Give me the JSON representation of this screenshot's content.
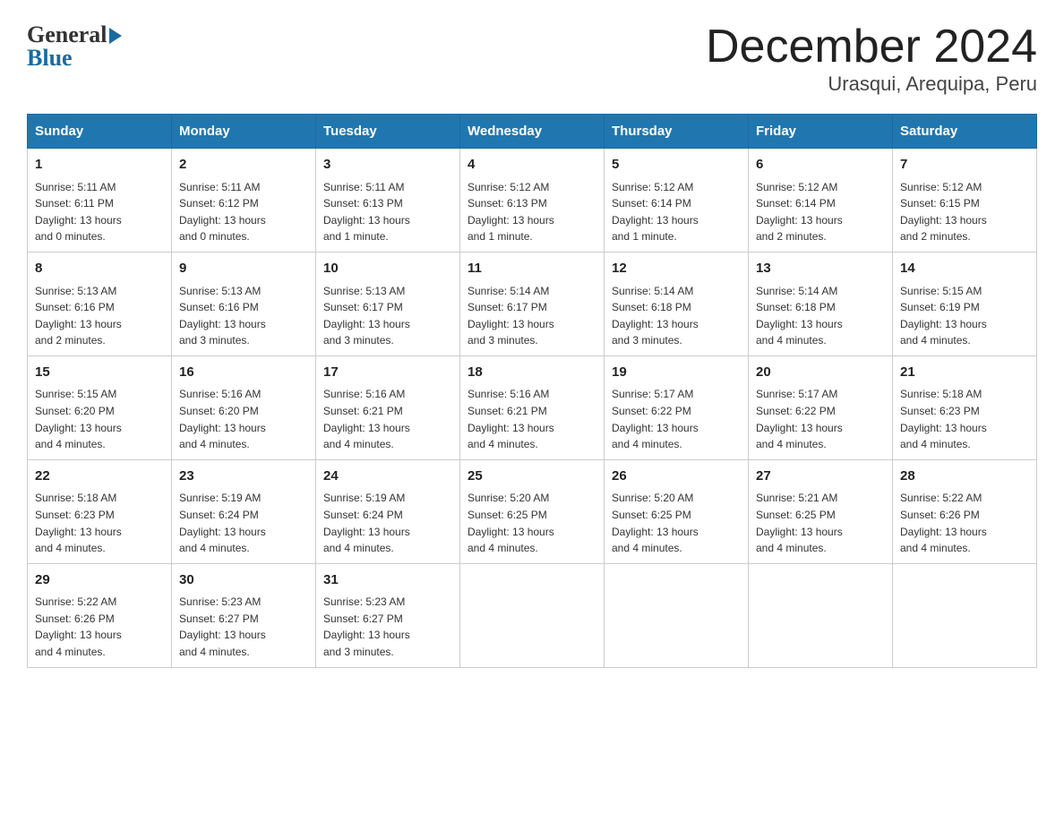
{
  "header": {
    "month_title": "December 2024",
    "location": "Urasqui, Arequipa, Peru",
    "logo_general": "General",
    "logo_blue": "Blue"
  },
  "days_of_week": [
    "Sunday",
    "Monday",
    "Tuesday",
    "Wednesday",
    "Thursday",
    "Friday",
    "Saturday"
  ],
  "weeks": [
    [
      {
        "day": "1",
        "info": "Sunrise: 5:11 AM\nSunset: 6:11 PM\nDaylight: 13 hours\nand 0 minutes."
      },
      {
        "day": "2",
        "info": "Sunrise: 5:11 AM\nSunset: 6:12 PM\nDaylight: 13 hours\nand 0 minutes."
      },
      {
        "day": "3",
        "info": "Sunrise: 5:11 AM\nSunset: 6:13 PM\nDaylight: 13 hours\nand 1 minute."
      },
      {
        "day": "4",
        "info": "Sunrise: 5:12 AM\nSunset: 6:13 PM\nDaylight: 13 hours\nand 1 minute."
      },
      {
        "day": "5",
        "info": "Sunrise: 5:12 AM\nSunset: 6:14 PM\nDaylight: 13 hours\nand 1 minute."
      },
      {
        "day": "6",
        "info": "Sunrise: 5:12 AM\nSunset: 6:14 PM\nDaylight: 13 hours\nand 2 minutes."
      },
      {
        "day": "7",
        "info": "Sunrise: 5:12 AM\nSunset: 6:15 PM\nDaylight: 13 hours\nand 2 minutes."
      }
    ],
    [
      {
        "day": "8",
        "info": "Sunrise: 5:13 AM\nSunset: 6:16 PM\nDaylight: 13 hours\nand 2 minutes."
      },
      {
        "day": "9",
        "info": "Sunrise: 5:13 AM\nSunset: 6:16 PM\nDaylight: 13 hours\nand 3 minutes."
      },
      {
        "day": "10",
        "info": "Sunrise: 5:13 AM\nSunset: 6:17 PM\nDaylight: 13 hours\nand 3 minutes."
      },
      {
        "day": "11",
        "info": "Sunrise: 5:14 AM\nSunset: 6:17 PM\nDaylight: 13 hours\nand 3 minutes."
      },
      {
        "day": "12",
        "info": "Sunrise: 5:14 AM\nSunset: 6:18 PM\nDaylight: 13 hours\nand 3 minutes."
      },
      {
        "day": "13",
        "info": "Sunrise: 5:14 AM\nSunset: 6:18 PM\nDaylight: 13 hours\nand 4 minutes."
      },
      {
        "day": "14",
        "info": "Sunrise: 5:15 AM\nSunset: 6:19 PM\nDaylight: 13 hours\nand 4 minutes."
      }
    ],
    [
      {
        "day": "15",
        "info": "Sunrise: 5:15 AM\nSunset: 6:20 PM\nDaylight: 13 hours\nand 4 minutes."
      },
      {
        "day": "16",
        "info": "Sunrise: 5:16 AM\nSunset: 6:20 PM\nDaylight: 13 hours\nand 4 minutes."
      },
      {
        "day": "17",
        "info": "Sunrise: 5:16 AM\nSunset: 6:21 PM\nDaylight: 13 hours\nand 4 minutes."
      },
      {
        "day": "18",
        "info": "Sunrise: 5:16 AM\nSunset: 6:21 PM\nDaylight: 13 hours\nand 4 minutes."
      },
      {
        "day": "19",
        "info": "Sunrise: 5:17 AM\nSunset: 6:22 PM\nDaylight: 13 hours\nand 4 minutes."
      },
      {
        "day": "20",
        "info": "Sunrise: 5:17 AM\nSunset: 6:22 PM\nDaylight: 13 hours\nand 4 minutes."
      },
      {
        "day": "21",
        "info": "Sunrise: 5:18 AM\nSunset: 6:23 PM\nDaylight: 13 hours\nand 4 minutes."
      }
    ],
    [
      {
        "day": "22",
        "info": "Sunrise: 5:18 AM\nSunset: 6:23 PM\nDaylight: 13 hours\nand 4 minutes."
      },
      {
        "day": "23",
        "info": "Sunrise: 5:19 AM\nSunset: 6:24 PM\nDaylight: 13 hours\nand 4 minutes."
      },
      {
        "day": "24",
        "info": "Sunrise: 5:19 AM\nSunset: 6:24 PM\nDaylight: 13 hours\nand 4 minutes."
      },
      {
        "day": "25",
        "info": "Sunrise: 5:20 AM\nSunset: 6:25 PM\nDaylight: 13 hours\nand 4 minutes."
      },
      {
        "day": "26",
        "info": "Sunrise: 5:20 AM\nSunset: 6:25 PM\nDaylight: 13 hours\nand 4 minutes."
      },
      {
        "day": "27",
        "info": "Sunrise: 5:21 AM\nSunset: 6:25 PM\nDaylight: 13 hours\nand 4 minutes."
      },
      {
        "day": "28",
        "info": "Sunrise: 5:22 AM\nSunset: 6:26 PM\nDaylight: 13 hours\nand 4 minutes."
      }
    ],
    [
      {
        "day": "29",
        "info": "Sunrise: 5:22 AM\nSunset: 6:26 PM\nDaylight: 13 hours\nand 4 minutes."
      },
      {
        "day": "30",
        "info": "Sunrise: 5:23 AM\nSunset: 6:27 PM\nDaylight: 13 hours\nand 4 minutes."
      },
      {
        "day": "31",
        "info": "Sunrise: 5:23 AM\nSunset: 6:27 PM\nDaylight: 13 hours\nand 3 minutes."
      },
      {
        "day": "",
        "info": ""
      },
      {
        "day": "",
        "info": ""
      },
      {
        "day": "",
        "info": ""
      },
      {
        "day": "",
        "info": ""
      }
    ]
  ]
}
